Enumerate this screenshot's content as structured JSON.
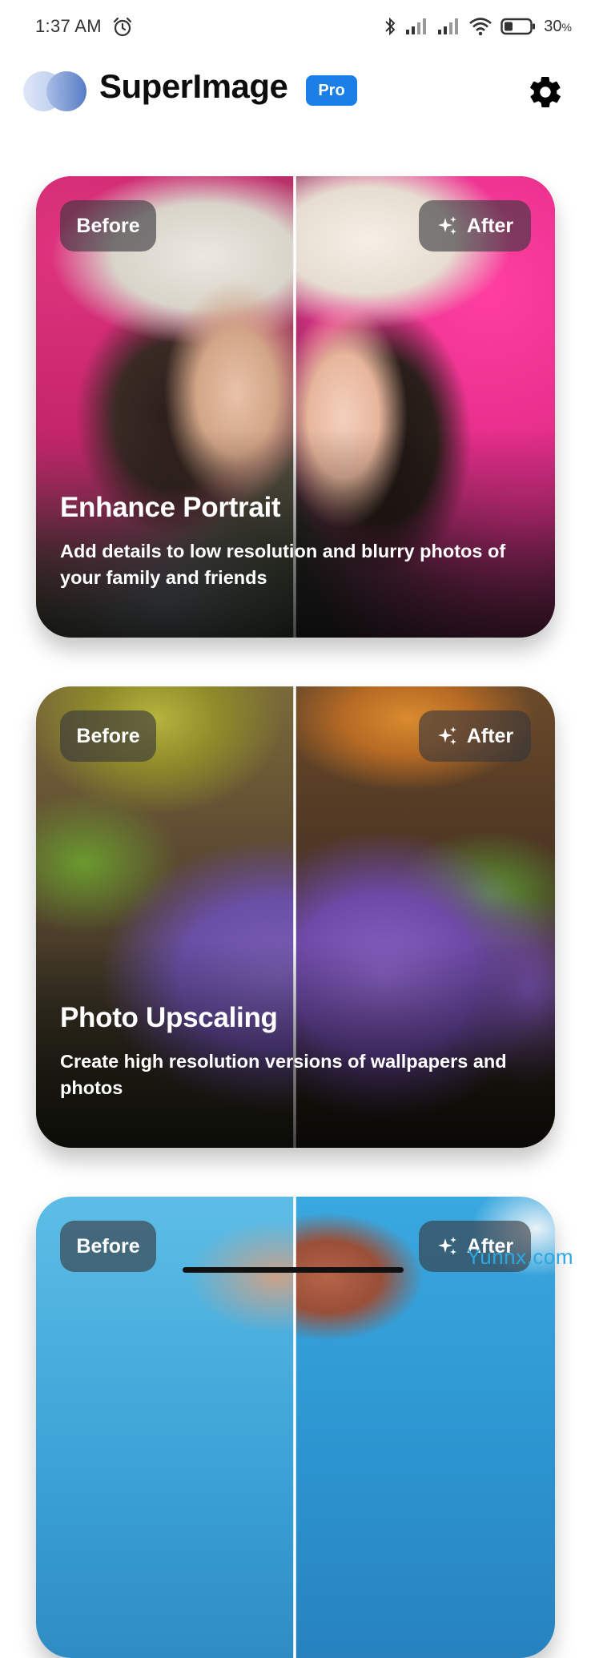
{
  "status_bar": {
    "time": "1:37 AM",
    "battery": "30"
  },
  "header": {
    "app_name": "SuperImage",
    "badge": "Pro"
  },
  "cards": [
    {
      "before_label": "Before",
      "after_label": "After",
      "title": "Enhance Portrait",
      "description": "Add details to low resolution and blurry photos of your family and friends"
    },
    {
      "before_label": "Before",
      "after_label": "After",
      "title": "Photo Upscaling",
      "description": "Create high resolution versions of wallpapers and photos"
    },
    {
      "before_label": "Before",
      "after_label": "After"
    }
  ],
  "watermark": "Yunnx.com",
  "colors": {
    "accent": "#1a7fe6",
    "watermark": "#2aa8e0"
  },
  "icons": [
    "alarm-icon",
    "bluetooth-icon",
    "signal-icon",
    "wifi-icon",
    "battery-icon",
    "settings-gear-icon",
    "sparkle-icon"
  ]
}
